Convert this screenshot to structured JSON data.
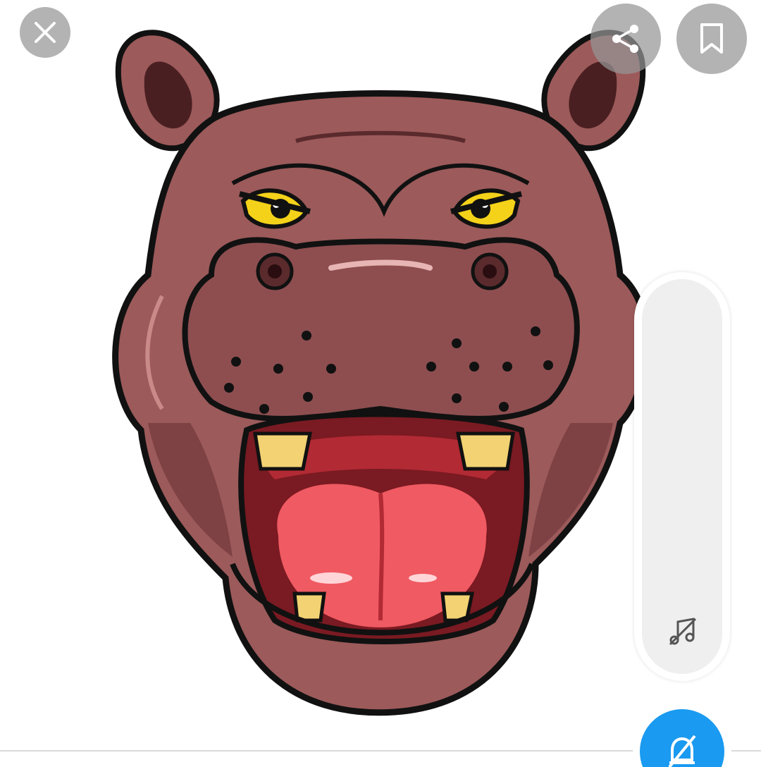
{
  "image": {
    "subject": "hippo-head-illustration"
  },
  "toolbar": {
    "close_icon": "close-icon",
    "share_icon": "share-icon",
    "bookmark_icon": "bookmark-icon"
  },
  "side_panel": {
    "icon": "music-note-off-icon"
  },
  "fab": {
    "icon": "bell-off-icon",
    "color": "#1a9af0"
  },
  "colors": {
    "button_overlay": "#969696",
    "hippo_skin": "#9c5a5a",
    "hippo_outline": "#111111",
    "eye": "#f4d21a",
    "tongue": "#f05a62",
    "teeth": "#f2d272"
  }
}
